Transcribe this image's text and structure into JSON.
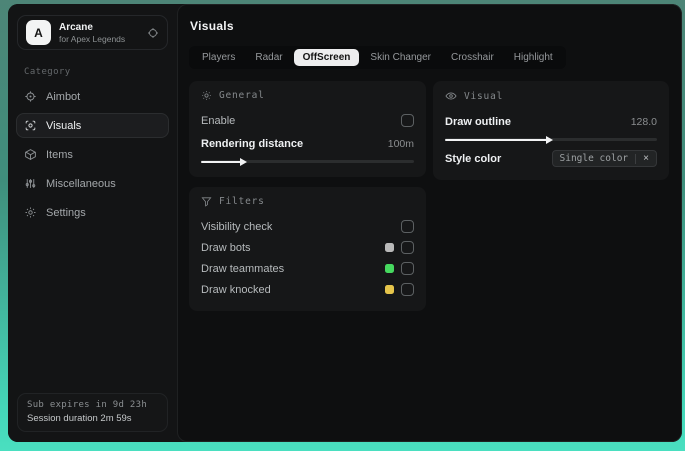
{
  "app": {
    "initial": "A",
    "name": "Arcane",
    "subtitle": "for Apex Legends"
  },
  "sidebar": {
    "category_label": "Category",
    "items": [
      {
        "label": "Aimbot",
        "icon": "crosshair-icon",
        "selected": false
      },
      {
        "label": "Visuals",
        "icon": "scan-eye-icon",
        "selected": true
      },
      {
        "label": "Items",
        "icon": "cube-icon",
        "selected": false
      },
      {
        "label": "Miscellaneous",
        "icon": "sliders-icon",
        "selected": false
      },
      {
        "label": "Settings",
        "icon": "gear-icon",
        "selected": false
      }
    ],
    "footer": {
      "line1": "Sub expires in 9d 23h",
      "line2": "Session duration 2m 59s"
    }
  },
  "main": {
    "title": "Visuals",
    "tabs": [
      {
        "label": "Players",
        "selected": false
      },
      {
        "label": "Radar",
        "selected": false
      },
      {
        "label": "OffScreen",
        "selected": true
      },
      {
        "label": "Skin Changer",
        "selected": false
      },
      {
        "label": "Crosshair",
        "selected": false
      },
      {
        "label": "Highlight",
        "selected": false
      }
    ],
    "panels": {
      "general": {
        "title": "General",
        "enable_label": "Enable",
        "enable_checked": false,
        "rendering": {
          "label": "Rendering distance",
          "value": "100m",
          "fill": "19%"
        }
      },
      "visual": {
        "title": "Visual",
        "outline": {
          "label": "Draw outline",
          "value": "128.0",
          "fill": "48%"
        },
        "style_color": {
          "label": "Style color",
          "tag": "Single color",
          "remove": "×"
        }
      },
      "filters": {
        "title": "Filters",
        "rows": [
          {
            "label": "Visibility check",
            "swatch": null,
            "checked": false
          },
          {
            "label": "Draw bots",
            "swatch": "#b9b9b9",
            "checked": false
          },
          {
            "label": "Draw teammates",
            "swatch": "#46d95f",
            "checked": false
          },
          {
            "label": "Draw knocked",
            "swatch": "#e6c54b",
            "checked": false
          }
        ]
      }
    }
  },
  "colors": {
    "frame_top": "#4d8577",
    "frame_bottom": "#45d8ba",
    "accent_pill": "#ededee"
  }
}
